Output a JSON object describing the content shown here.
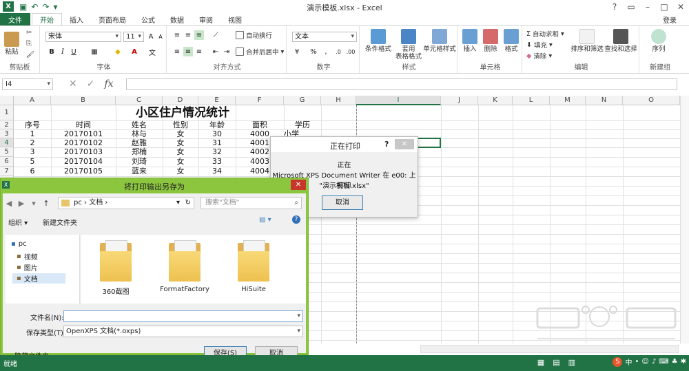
{
  "app": {
    "title": "演示模板.xlsx - Excel",
    "logo_letter": "X",
    "login": "登录"
  },
  "tabs": [
    "文件",
    "开始",
    "插入",
    "页面布局",
    "公式",
    "数据",
    "审阅",
    "视图"
  ],
  "ribbon": {
    "clipboard": {
      "paste": "粘贴",
      "label": "剪贴板"
    },
    "font": {
      "name": "宋体",
      "size": "11",
      "label": "字体"
    },
    "alignment": {
      "wrap": "自动换行",
      "merge": "合并后居中",
      "label": "对齐方式"
    },
    "number": {
      "format": "文本",
      "label": "数字"
    },
    "styles": {
      "conditional": "条件格式",
      "table": "套用\n表格格式",
      "cell_style": "单元格样式",
      "label": "样式"
    },
    "cells": {
      "insert": "插入",
      "delete": "删除",
      "format": "格式",
      "label": "单元格"
    },
    "editing": {
      "autosum": "自动求和",
      "fill": "填充",
      "clear": "清除",
      "sort": "排序和筛选",
      "find": "查找和选择",
      "label": "编辑"
    },
    "newgroup": {
      "sequence": "序列",
      "label": "新建组"
    }
  },
  "formula_bar": {
    "name_box": "I4",
    "fx": "fx",
    "value": ""
  },
  "sheet": {
    "columns": [
      "A",
      "B",
      "C",
      "D",
      "E",
      "F",
      "G",
      "H",
      "I",
      "J",
      "K",
      "L",
      "M",
      "N",
      "O"
    ],
    "selected_column": "I",
    "selected_row": "4",
    "rows": [
      "1",
      "2",
      "3",
      "4",
      "5",
      "6",
      "7"
    ],
    "title": "小区住户情况统计",
    "headers": [
      "序号",
      "时间",
      "姓名",
      "性别",
      "年龄",
      "面积",
      "学历"
    ],
    "data": [
      [
        "1",
        "20170101",
        "林与",
        "女",
        "30",
        "4000",
        "小学"
      ],
      [
        "2",
        "20170102",
        "赵雅",
        "女",
        "31",
        "4001",
        ""
      ],
      [
        "3",
        "20170103",
        "郑楠",
        "女",
        "32",
        "4002",
        ""
      ],
      [
        "5",
        "20170104",
        "刘琦",
        "女",
        "33",
        "4003",
        ""
      ],
      [
        "6",
        "20170105",
        "蓝来",
        "女",
        "34",
        "4004",
        ""
      ]
    ]
  },
  "print_dialog": {
    "title": "正在打印",
    "help": "?",
    "status": "正在",
    "line1": "Microsoft XPS Document Writer 在 e00: 上打印",
    "line2": "\"演示模板.xlsx\"",
    "cancel": "取消"
  },
  "save_dialog": {
    "title": "将打印输出另存为",
    "path": [
      "pc",
      "文档"
    ],
    "search_placeholder": "搜索\"文档\"",
    "organize": "组织 ▾",
    "new_folder": "新建文件夹",
    "nav": [
      "pc",
      "视频",
      "图片",
      "文档"
    ],
    "files": [
      "360截图",
      "FormatFactory",
      "HiSuite"
    ],
    "filename_label": "文件名(N):",
    "filename_value": "",
    "filetype_label": "保存类型(T):",
    "filetype_value": "OpenXPS 文档(*.oxps)",
    "hide_folders": "隐藏文件夹",
    "save": "保存(S)",
    "cancel": "取消"
  },
  "status": {
    "ready": "就绪",
    "ime": "中"
  },
  "colors": {
    "excel_green": "#217346",
    "dialog_green": "#8cc63f",
    "close_red": "#c7352b"
  }
}
